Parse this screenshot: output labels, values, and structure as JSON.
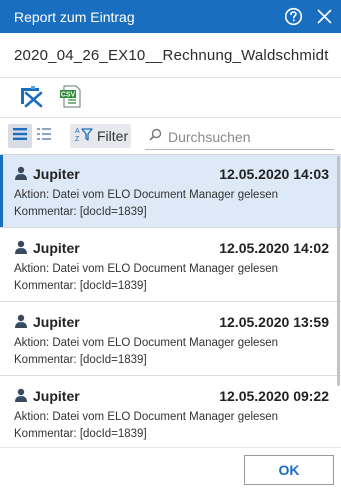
{
  "dialog": {
    "title": "Report zum Eintrag",
    "help_icon": "help-circle-icon",
    "close_icon": "close-icon"
  },
  "document": {
    "name": "2020_04_26_EX10__Rechnung_Waldschmidt"
  },
  "toolbar": {
    "icons": [
      "tools-cross-icon",
      "csv-export-icon"
    ],
    "csv_label": "CSV"
  },
  "filterbar": {
    "view_list_icon": "list-view-icon",
    "view_compact_icon": "compact-list-icon",
    "filter_label": "Filter",
    "filter_icon": "filter-az-icon",
    "search_placeholder": "Durchsuchen",
    "search_icon": "search-icon"
  },
  "entries": [
    {
      "user": "Jupiter",
      "date": "12.05.2020 14:03",
      "action": "Aktion: Datei vom ELO Document Manager gelesen",
      "comment": "Kommentar: [docId=1839]",
      "selected": true
    },
    {
      "user": "Jupiter",
      "date": "12.05.2020 14:02",
      "action": "Aktion: Datei vom ELO Document Manager gelesen",
      "comment": "Kommentar: [docId=1839]",
      "selected": false
    },
    {
      "user": "Jupiter",
      "date": "12.05.2020 13:59",
      "action": "Aktion: Datei vom ELO Document Manager gelesen",
      "comment": "Kommentar: [docId=1839]",
      "selected": false
    },
    {
      "user": "Jupiter",
      "date": "12.05.2020 09:22",
      "action": "Aktion: Datei vom ELO Document Manager gelesen",
      "comment": "Kommentar: [docId=1839]",
      "selected": false
    }
  ],
  "footer": {
    "ok_label": "OK"
  },
  "colors": {
    "accent": "#1a6ec0",
    "selected_row": "#dde9f7"
  }
}
